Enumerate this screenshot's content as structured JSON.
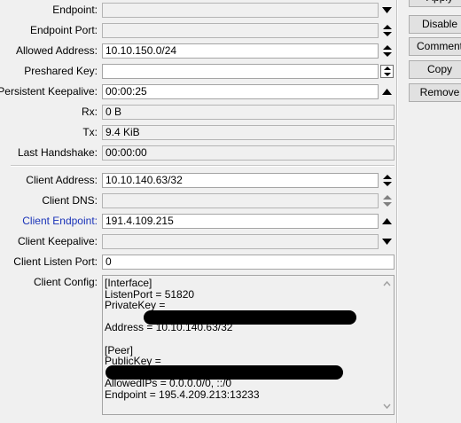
{
  "fields": {
    "endpoint": {
      "label": "Endpoint:",
      "value": ""
    },
    "endpoint_port": {
      "label": "Endpoint Port:",
      "value": ""
    },
    "allowed_address": {
      "label": "Allowed Address:",
      "value": "10.10.150.0/24"
    },
    "preshared_key": {
      "label": "Preshared Key:",
      "value": ""
    },
    "persistent_keepalive": {
      "label": "Persistent Keepalive:",
      "value": "00:00:25"
    },
    "rx": {
      "label": "Rx:",
      "value": "0 B"
    },
    "tx": {
      "label": "Tx:",
      "value": "9.4 KiB"
    },
    "last_handshake": {
      "label": "Last Handshake:",
      "value": "00:00:00"
    },
    "client_address": {
      "label": "Client Address:",
      "value": "10.10.140.63/32"
    },
    "client_dns": {
      "label": "Client DNS:",
      "value": ""
    },
    "client_endpoint": {
      "label": "Client Endpoint:",
      "value": "191.4.109.215"
    },
    "client_keepalive": {
      "label": "Client Keepalive:",
      "value": ""
    },
    "client_listen_port": {
      "label": "Client Listen Port:",
      "value": "0"
    },
    "client_config": {
      "label": "Client Config:"
    }
  },
  "client_config_lines": [
    "[Interface]",
    "ListenPort = 51820",
    "PrivateKey =",
    "",
    "Address = 10.10.140.63/32",
    "",
    "[Peer]",
    "PublicKey =",
    "",
    "AllowedIPs = 0.0.0.0/0, ::/0",
    "Endpoint = 195.4.209.213:13233"
  ],
  "buttons": {
    "apply": "Apply",
    "disable": "Disable",
    "comment": "Comment",
    "copy": "Copy",
    "remove": "Remove"
  },
  "colors": {
    "highlight_label": "#1a33b8"
  }
}
